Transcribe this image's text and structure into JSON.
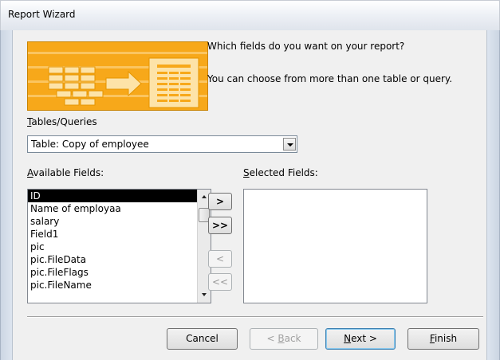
{
  "window": {
    "title": "Report Wizard"
  },
  "intro": {
    "question": "Which fields do you want on your report?",
    "hint": "You can choose from more than one table or query."
  },
  "tables": {
    "label_accel": "T",
    "label_rest": "ables/Queries",
    "selected_value": "Table: Copy of employee"
  },
  "available": {
    "label_accel": "A",
    "label_rest": "vailable Fields:",
    "items": [
      "ID",
      "Name of employaa",
      "salary",
      "Field1",
      "pic",
      "pic.FileData",
      "pic.FileFlags",
      "pic.FileName"
    ],
    "selected_index": 0
  },
  "selected_fields": {
    "label_accel": "S",
    "label_rest": "elected Fields:",
    "items": []
  },
  "move_buttons": {
    "add_one": ">",
    "add_all": ">>",
    "remove_one": "<",
    "remove_all": "<<"
  },
  "footer": {
    "cancel": "Cancel",
    "back_prefix": "< ",
    "back_accel": "B",
    "back_rest": "ack",
    "next_accel": "N",
    "next_rest": "ext >",
    "finish_accel": "F",
    "finish_rest": "inish"
  },
  "colors": {
    "banner_orange": "#f7a81a",
    "selection": "#000000",
    "dialog_bg": "#f0f0f0"
  }
}
